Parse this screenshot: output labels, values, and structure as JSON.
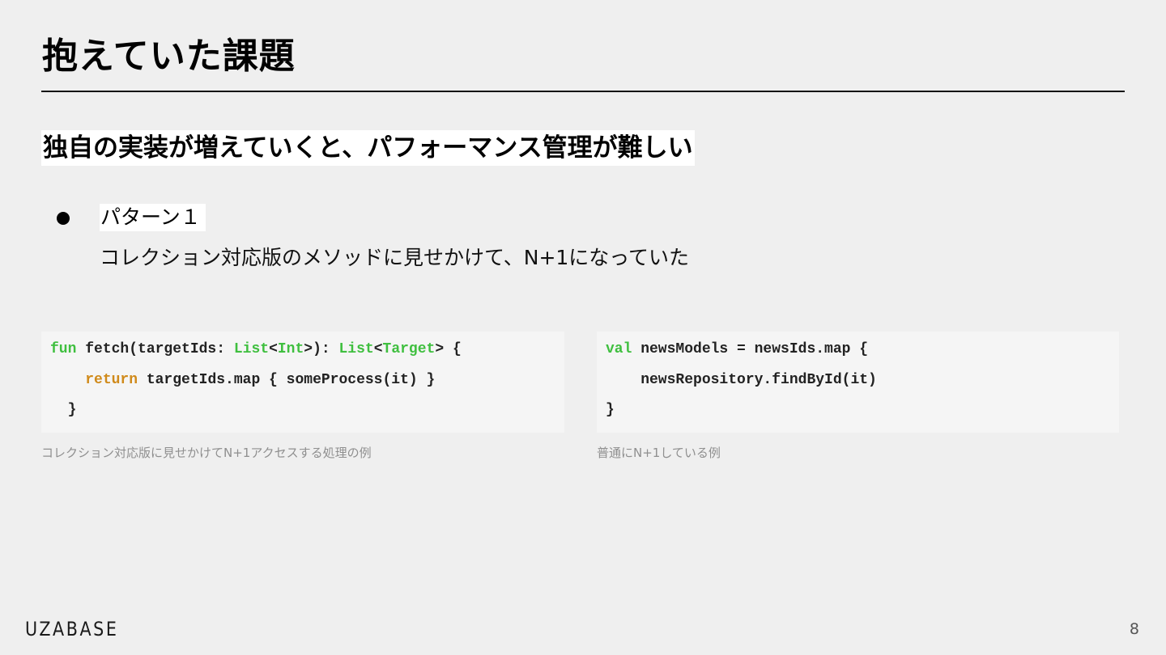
{
  "slide": {
    "title": "抱えていた課題",
    "subtitle": "独自の実装が増えていくと、パフォーマンス管理が難しい",
    "bullet": {
      "label": "パターン１",
      "detail": "コレクション対応版のメソッドに見せかけて、N+1になっていた"
    },
    "code_left": {
      "line1": {
        "kw_fun": "fun",
        "t1": " fetch(targetIds: ",
        "type_list1": "List",
        "t2": "<",
        "type_int": "Int",
        "t3": ">): ",
        "type_list2": "List",
        "t4": "<",
        "type_target": "Target",
        "t5": "> {"
      },
      "line2": {
        "indent": "    ",
        "kw_return": "return",
        "t1": " targetIds.map { someProcess(it) }"
      },
      "line3": "  }",
      "caption": "コレクション対応版に見せかけてN+1アクセスする処理の例"
    },
    "code_right": {
      "line1": {
        "kw_val": "val",
        "t1": " newsModels = newsIds.map {"
      },
      "line2": "    newsRepository.findById(it)",
      "line3": "}",
      "caption": "普通にN+1している例"
    },
    "footer": {
      "logo": "UZABASE",
      "page_number": "8"
    },
    "colors": {
      "background": "#efefef",
      "code_background": "#f5f5f5",
      "keyword_green": "#3fbf3f",
      "keyword_orange": "#d08a1a",
      "caption_gray": "#8f8f8f"
    }
  }
}
